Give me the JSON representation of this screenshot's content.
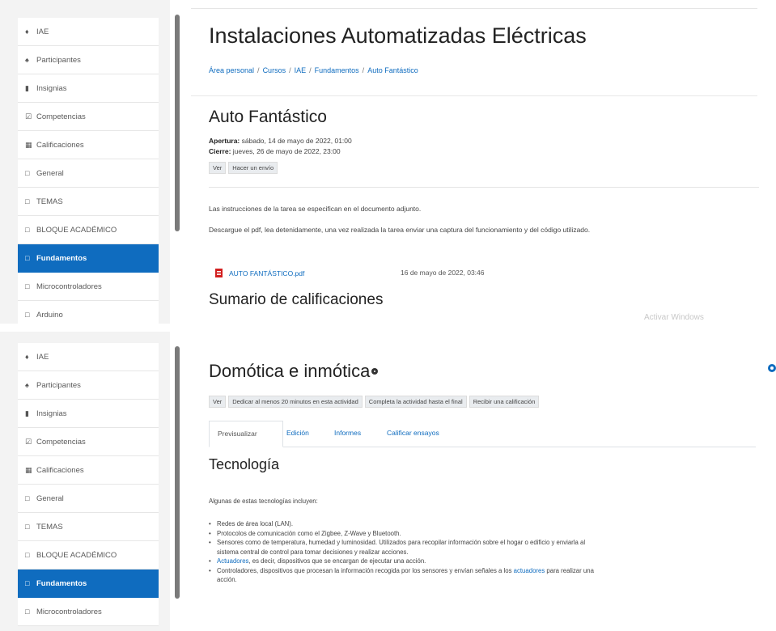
{
  "sidebar": {
    "items": [
      {
        "label": "IAE",
        "icon": "graduation-cap-icon",
        "glyph": "♦"
      },
      {
        "label": "Participantes",
        "icon": "users-icon",
        "glyph": "♠"
      },
      {
        "label": "Insignias",
        "icon": "shield-icon",
        "glyph": "▮"
      },
      {
        "label": "Competencias",
        "icon": "check-square-icon",
        "glyph": "☑"
      },
      {
        "label": "Calificaciones",
        "icon": "table-icon",
        "glyph": "▦"
      },
      {
        "label": "General",
        "icon": "folder-icon",
        "glyph": "□"
      },
      {
        "label": "TEMAS",
        "icon": "folder-icon",
        "glyph": "□"
      },
      {
        "label": "BLOQUE ACADÉMICO",
        "icon": "folder-icon",
        "glyph": "□"
      },
      {
        "label": "Fundamentos",
        "icon": "folder-icon",
        "glyph": "□",
        "active": true
      },
      {
        "label": "Microcontroladores",
        "icon": "folder-icon",
        "glyph": "□"
      },
      {
        "label": "Arduino",
        "icon": "folder-icon",
        "glyph": "□"
      }
    ]
  },
  "top": {
    "title": "Instalaciones Automatizadas Eléctricas",
    "breadcrumb": [
      "Área personal",
      "Cursos",
      "IAE",
      "Fundamentos",
      "Auto Fantástico"
    ],
    "assignment_title": "Auto Fantástico",
    "apertura_label": "Apertura:",
    "apertura_value": "sábado, 14 de mayo de 2022, 01:00",
    "cierre_label": "Cierre:",
    "cierre_value": "jueves, 26 de mayo de 2022, 23:00",
    "badges": [
      "Ver",
      "Hacer un envío"
    ],
    "para1": "Las instrucciones de la tarea se especifican en el documento adjunto.",
    "para2": "Descargue el pdf, lea detenidamente, una vez realizada la tarea enviar una captura del funcionamiento y del código utilizado.",
    "file_name": "AUTO FANTÁSTICO.pdf",
    "file_date": "16 de mayo de 2022, 03:46",
    "summary_title": "Sumario de calificaciones",
    "watermark": "Activar Windows"
  },
  "bottom": {
    "title": "Domótica e inmótica",
    "badges": [
      "Ver",
      "Dedicar al menos 20 minutos en esta actividad",
      "Completa la actividad hasta el final",
      "Recibir una calificación"
    ],
    "tabs": [
      "Previsualizar",
      "Edición",
      "Informes",
      "Calificar ensayos"
    ],
    "section_title": "Tecnología",
    "intro": "Algunas de estas tecnologías incluyen:",
    "bullets": {
      "b1": "Redes de área local (LAN).",
      "b2": "Protocolos de comunicación como el Zigbee, Z-Wave y Bluetooth.",
      "b3a": "Sensores como de temperatura, humedad y luminosidad. Utilizados para recopilar información sobre el hogar o edificio y enviarla al",
      "b3b": "sistema central de control para tomar decisiones y realizar acciones.",
      "b4_link": "Actuadores",
      "b4_rest": ", es decir, dispositivos que se encargan de ejecutar una acción.",
      "b5a": "Controladores, dispositivos que procesan la información recogida por los sensores y envían señales a los ",
      "b5_link": "actuadores",
      "b5b": " para realizar una",
      "b5c": "acción."
    }
  }
}
